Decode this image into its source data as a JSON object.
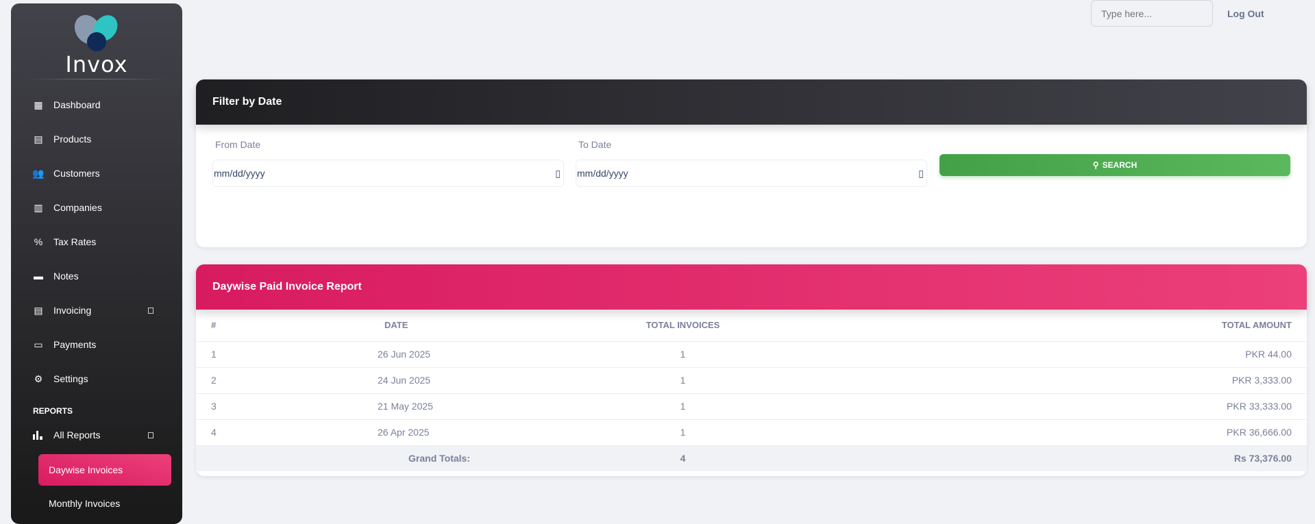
{
  "app": {
    "name": "Invox"
  },
  "sidebar": {
    "items": [
      {
        "label": "Dashboard",
        "icon": "dashboard-icon"
      },
      {
        "label": "Products",
        "icon": "archive-icon"
      },
      {
        "label": "Customers",
        "icon": "people-icon"
      },
      {
        "label": "Companies",
        "icon": "building-icon"
      },
      {
        "label": "Tax Rates",
        "icon": "percent-icon"
      },
      {
        "label": "Notes",
        "icon": "note-icon"
      },
      {
        "label": "Invoicing",
        "icon": "receipt-icon"
      },
      {
        "label": "Payments",
        "icon": "payments-icon"
      },
      {
        "label": "Settings",
        "icon": "gear-icon"
      }
    ],
    "section": "REPORTS",
    "reports": {
      "label": "All Reports",
      "active": "Daywise Invoices",
      "next": "Monthly Invoices"
    }
  },
  "topbar": {
    "search_placeholder": "Type here...",
    "logout": "Log Out"
  },
  "filter": {
    "title": "Filter by Date",
    "from_label": "From Date",
    "to_label": "To Date",
    "from_value": "mm/dd/yyyy",
    "to_value": "mm/dd/yyyy",
    "search_label": "SEARCH"
  },
  "report": {
    "title": "Daywise Paid Invoice Report",
    "columns": [
      "#",
      "DATE",
      "TOTAL INVOICES",
      "TOTAL AMOUNT"
    ],
    "rows": [
      [
        "1",
        "26 Jun 2025",
        "1",
        "PKR 44.00"
      ],
      [
        "2",
        "24 Jun 2025",
        "1",
        "PKR 3,333.00"
      ],
      [
        "3",
        "21 May 2025",
        "1",
        "PKR 33,333.00"
      ],
      [
        "4",
        "26 Apr 2025",
        "1",
        "PKR 36,666.00"
      ]
    ],
    "totals": {
      "label": "Grand Totals:",
      "invoices": "4",
      "amount": "Rs 73,376.00"
    }
  },
  "colors": {
    "accent": "#e91e63",
    "success": "#4caf50",
    "dark": "#1f1f22"
  }
}
